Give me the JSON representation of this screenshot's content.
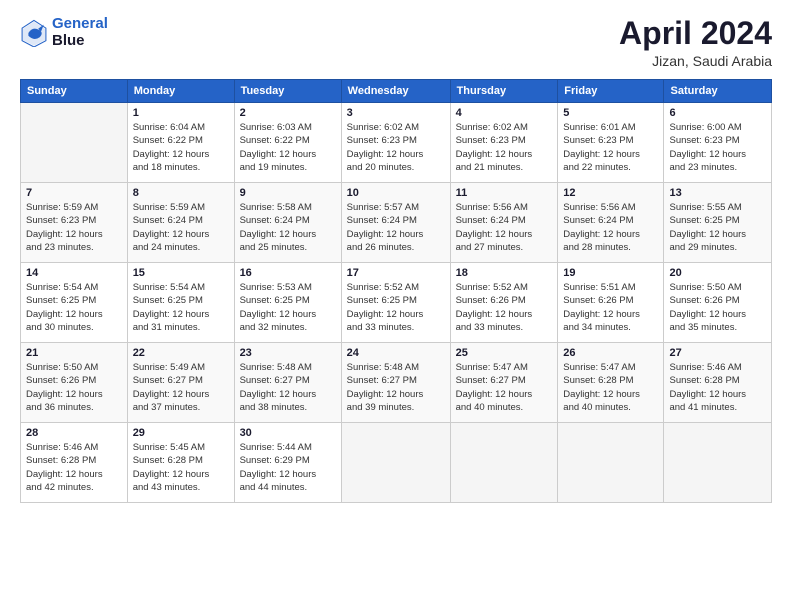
{
  "logo": {
    "line1": "General",
    "line2": "Blue"
  },
  "title": "April 2024",
  "location": "Jizan, Saudi Arabia",
  "header_days": [
    "Sunday",
    "Monday",
    "Tuesday",
    "Wednesday",
    "Thursday",
    "Friday",
    "Saturday"
  ],
  "weeks": [
    [
      {
        "num": "",
        "info": ""
      },
      {
        "num": "1",
        "info": "Sunrise: 6:04 AM\nSunset: 6:22 PM\nDaylight: 12 hours\nand 18 minutes."
      },
      {
        "num": "2",
        "info": "Sunrise: 6:03 AM\nSunset: 6:22 PM\nDaylight: 12 hours\nand 19 minutes."
      },
      {
        "num": "3",
        "info": "Sunrise: 6:02 AM\nSunset: 6:23 PM\nDaylight: 12 hours\nand 20 minutes."
      },
      {
        "num": "4",
        "info": "Sunrise: 6:02 AM\nSunset: 6:23 PM\nDaylight: 12 hours\nand 21 minutes."
      },
      {
        "num": "5",
        "info": "Sunrise: 6:01 AM\nSunset: 6:23 PM\nDaylight: 12 hours\nand 22 minutes."
      },
      {
        "num": "6",
        "info": "Sunrise: 6:00 AM\nSunset: 6:23 PM\nDaylight: 12 hours\nand 23 minutes."
      }
    ],
    [
      {
        "num": "7",
        "info": "Sunrise: 5:59 AM\nSunset: 6:23 PM\nDaylight: 12 hours\nand 23 minutes."
      },
      {
        "num": "8",
        "info": "Sunrise: 5:59 AM\nSunset: 6:24 PM\nDaylight: 12 hours\nand 24 minutes."
      },
      {
        "num": "9",
        "info": "Sunrise: 5:58 AM\nSunset: 6:24 PM\nDaylight: 12 hours\nand 25 minutes."
      },
      {
        "num": "10",
        "info": "Sunrise: 5:57 AM\nSunset: 6:24 PM\nDaylight: 12 hours\nand 26 minutes."
      },
      {
        "num": "11",
        "info": "Sunrise: 5:56 AM\nSunset: 6:24 PM\nDaylight: 12 hours\nand 27 minutes."
      },
      {
        "num": "12",
        "info": "Sunrise: 5:56 AM\nSunset: 6:24 PM\nDaylight: 12 hours\nand 28 minutes."
      },
      {
        "num": "13",
        "info": "Sunrise: 5:55 AM\nSunset: 6:25 PM\nDaylight: 12 hours\nand 29 minutes."
      }
    ],
    [
      {
        "num": "14",
        "info": "Sunrise: 5:54 AM\nSunset: 6:25 PM\nDaylight: 12 hours\nand 30 minutes."
      },
      {
        "num": "15",
        "info": "Sunrise: 5:54 AM\nSunset: 6:25 PM\nDaylight: 12 hours\nand 31 minutes."
      },
      {
        "num": "16",
        "info": "Sunrise: 5:53 AM\nSunset: 6:25 PM\nDaylight: 12 hours\nand 32 minutes."
      },
      {
        "num": "17",
        "info": "Sunrise: 5:52 AM\nSunset: 6:25 PM\nDaylight: 12 hours\nand 33 minutes."
      },
      {
        "num": "18",
        "info": "Sunrise: 5:52 AM\nSunset: 6:26 PM\nDaylight: 12 hours\nand 33 minutes."
      },
      {
        "num": "19",
        "info": "Sunrise: 5:51 AM\nSunset: 6:26 PM\nDaylight: 12 hours\nand 34 minutes."
      },
      {
        "num": "20",
        "info": "Sunrise: 5:50 AM\nSunset: 6:26 PM\nDaylight: 12 hours\nand 35 minutes."
      }
    ],
    [
      {
        "num": "21",
        "info": "Sunrise: 5:50 AM\nSunset: 6:26 PM\nDaylight: 12 hours\nand 36 minutes."
      },
      {
        "num": "22",
        "info": "Sunrise: 5:49 AM\nSunset: 6:27 PM\nDaylight: 12 hours\nand 37 minutes."
      },
      {
        "num": "23",
        "info": "Sunrise: 5:48 AM\nSunset: 6:27 PM\nDaylight: 12 hours\nand 38 minutes."
      },
      {
        "num": "24",
        "info": "Sunrise: 5:48 AM\nSunset: 6:27 PM\nDaylight: 12 hours\nand 39 minutes."
      },
      {
        "num": "25",
        "info": "Sunrise: 5:47 AM\nSunset: 6:27 PM\nDaylight: 12 hours\nand 40 minutes."
      },
      {
        "num": "26",
        "info": "Sunrise: 5:47 AM\nSunset: 6:28 PM\nDaylight: 12 hours\nand 40 minutes."
      },
      {
        "num": "27",
        "info": "Sunrise: 5:46 AM\nSunset: 6:28 PM\nDaylight: 12 hours\nand 41 minutes."
      }
    ],
    [
      {
        "num": "28",
        "info": "Sunrise: 5:46 AM\nSunset: 6:28 PM\nDaylight: 12 hours\nand 42 minutes."
      },
      {
        "num": "29",
        "info": "Sunrise: 5:45 AM\nSunset: 6:28 PM\nDaylight: 12 hours\nand 43 minutes."
      },
      {
        "num": "30",
        "info": "Sunrise: 5:44 AM\nSunset: 6:29 PM\nDaylight: 12 hours\nand 44 minutes."
      },
      {
        "num": "",
        "info": ""
      },
      {
        "num": "",
        "info": ""
      },
      {
        "num": "",
        "info": ""
      },
      {
        "num": "",
        "info": ""
      }
    ]
  ]
}
